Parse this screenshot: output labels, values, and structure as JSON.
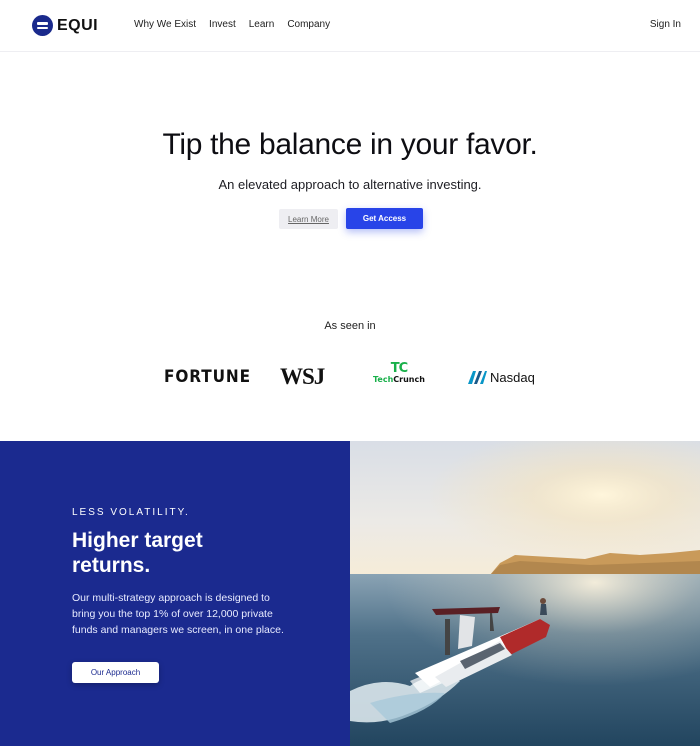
{
  "nav": {
    "logo_text": "EQUI",
    "links": [
      "Why We Exist",
      "Invest",
      "Learn",
      "Company"
    ],
    "signin": "Sign In"
  },
  "hero": {
    "title": "Tip the balance in your favor.",
    "subtitle": "An elevated approach to alternative investing.",
    "learn_more": "Learn More",
    "get_access": "Get Access"
  },
  "press": {
    "heading": "As seen in",
    "fortune": "FORTUNE",
    "wsj": "WSJ",
    "techcrunch_mark": "TC",
    "techcrunch_tech": "Tech",
    "techcrunch_crunch": "Crunch",
    "nasdaq": "Nasdaq"
  },
  "feature": {
    "kicker": "LESS VOLATILITY.",
    "headline": "Higher target returns.",
    "body": "Our multi-strategy approach is designed to bring you the top 1% of over 12,000 private funds and managers we screen, in one place.",
    "button": "Our Approach"
  },
  "colors": {
    "brand_navy": "#1b2a8f",
    "accent_blue": "#2844e8",
    "techcrunch_green": "#19b04a",
    "nasdaq_blue": "#0996c7"
  }
}
